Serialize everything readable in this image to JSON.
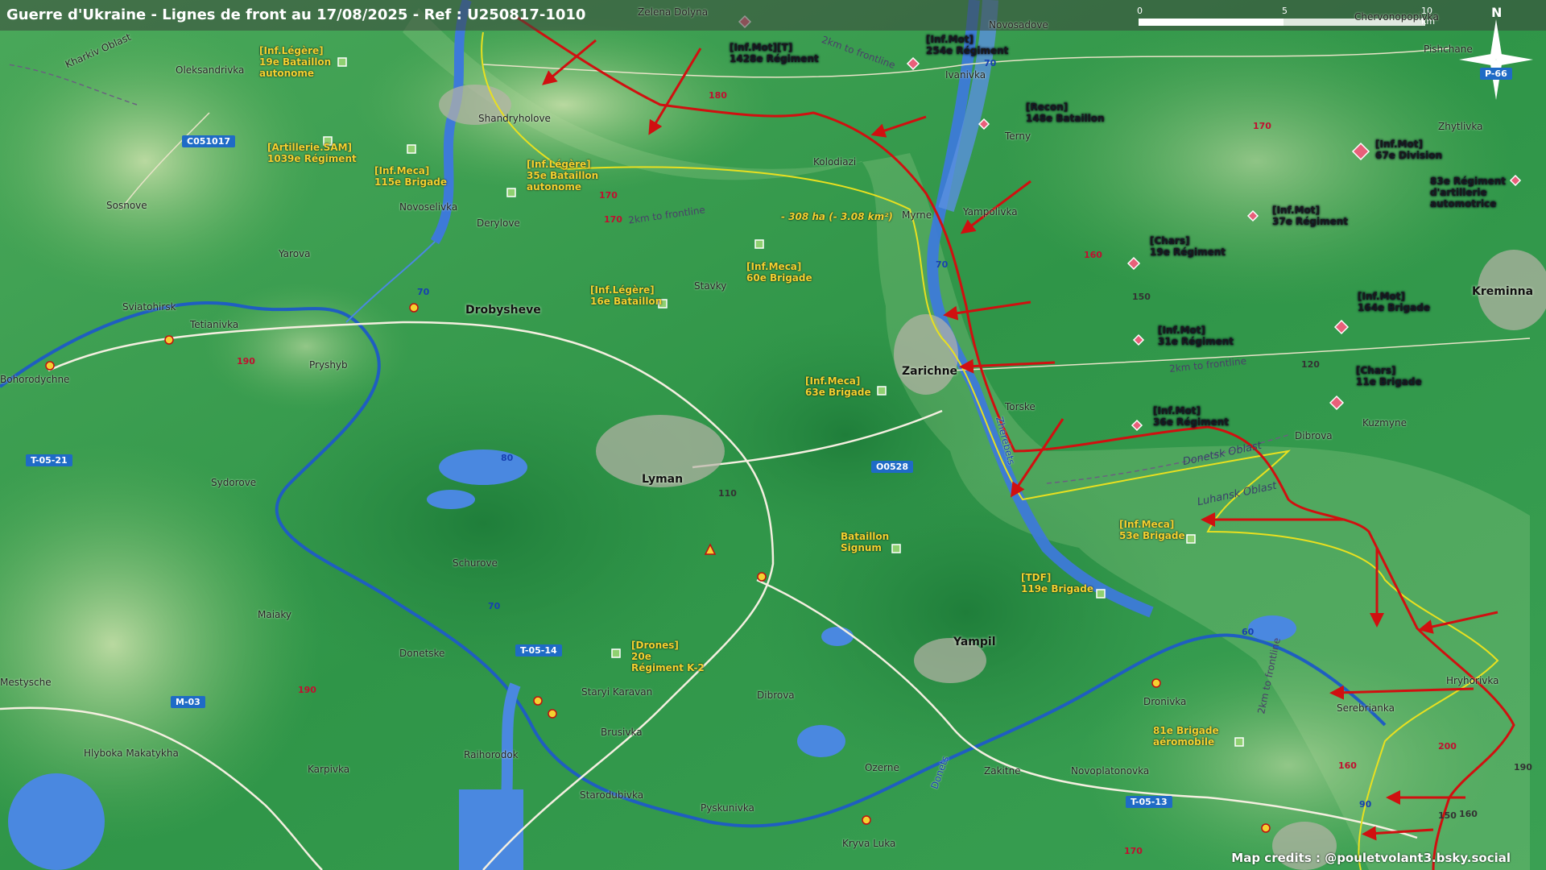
{
  "title": "Guerre d'Ukraine - Lignes de front au 17/08/2025 - Ref : U250817-1010",
  "credits": "Map credits : @pouletvolant3.bsky.social",
  "scale": {
    "labels": [
      "0",
      "5",
      "10 km"
    ]
  },
  "compass": {
    "north": "N",
    "icon": "compass-rose-icon"
  },
  "colors": {
    "ukraine": "#f5d130",
    "russia": "#e0283c",
    "front_line": "#d01010",
    "ua_frontline": "#e8e020"
  },
  "ukrainian_units": [
    {
      "id": "u1",
      "label": "[Inf.Légère]\n19e Bataillon\nautonome"
    },
    {
      "id": "u2",
      "label": "[Artillerie.SAM]\n1039e Régiment"
    },
    {
      "id": "u3",
      "label": "[Inf.Meca]\n115e Brigade"
    },
    {
      "id": "u4",
      "label": "[Inf.Légère]\n35e Bataillon\nautonome"
    },
    {
      "id": "u5",
      "label": "[Inf.Meca]\n60e Brigade"
    },
    {
      "id": "u6",
      "label": "[Inf.Légère]\n16e Bataillon"
    },
    {
      "id": "u7",
      "label": "[Inf.Meca]\n63e Brigade"
    },
    {
      "id": "u8",
      "label": "Bataillon\nSignum"
    },
    {
      "id": "u9",
      "label": "[TDF]\n119e Brigade"
    },
    {
      "id": "u10",
      "label": "[Inf.Meca]\n53e Brigade"
    },
    {
      "id": "u11",
      "label": "[Drones]\n20e\nRégiment K-2"
    },
    {
      "id": "u12",
      "label": "81e Brigade\naéromobile"
    }
  ],
  "russian_units": [
    {
      "id": "r1",
      "label": "[Inf.Mot][T]\n1428e Régiment"
    },
    {
      "id": "r2",
      "label": "[Inf.Mot]\n254e Régiment"
    },
    {
      "id": "r3",
      "label": "[Recon]\n148e Bataillon"
    },
    {
      "id": "r4",
      "label": "[Inf.Mot]\n67e Division"
    },
    {
      "id": "r5",
      "label": "83e Régiment\nd'artillerie\nautomotrice"
    },
    {
      "id": "r6",
      "label": "[Inf.Mot]\n37e Régiment"
    },
    {
      "id": "r7",
      "label": "[Chars]\n19e Régiment"
    },
    {
      "id": "r8",
      "label": "[Inf.Mot]\n164e Brigade"
    },
    {
      "id": "r9",
      "label": "[Inf.Mot]\n31e Régiment"
    },
    {
      "id": "r10",
      "label": "[Chars]\n11e Brigade"
    },
    {
      "id": "r11",
      "label": "[Inf.Mot]\n36e Régiment"
    }
  ],
  "cities": [
    "Drobysheve",
    "Lyman",
    "Zarichne",
    "Yampil",
    "Kreminna"
  ],
  "places": [
    "Zelena Dolyna",
    "Novosadove",
    "Chervonopopivka",
    "Pishchane",
    "Kharkiv Oblast",
    "Oleksandrivka",
    "Shandryholove",
    "Ivanivka",
    "Terny",
    "Zhytlivka",
    "Kolodiazi",
    "Myrne",
    "Yampolivka",
    "Sosnove",
    "Novoselivka",
    "Derylove",
    "Yarova",
    "Stavky",
    "Sviatohirsk",
    "Tetianivka",
    "Bohorodychne",
    "Pryshyb",
    "Torske",
    "Dibrova",
    "Kuzmyne",
    "Sydorove",
    "Schurove",
    "Maiaky",
    "Donetske",
    "Staryi Karavan",
    "Brusivka",
    "Raihorodok",
    "Dibrova",
    "Hlyboka Makatykha",
    "Karpivka",
    "Ozerne",
    "Zakitne",
    "Novoplatonovka",
    "Dronivka",
    "Serebrianka",
    "Hryhorivka",
    "Starodubivka",
    "Pyskunivka",
    "Kryva Luka",
    "Mestysche",
    "Zherebets",
    "Donets"
  ],
  "roads": [
    "C051017",
    "T-05-21",
    "T-05-14",
    "M-03",
    "O0528",
    "T-05-13",
    "P-66"
  ],
  "elevations_red": [
    "180",
    "170",
    "170",
    "170",
    "160",
    "190",
    "190",
    "160",
    "200",
    "170"
  ],
  "elevations_blue": [
    "70",
    "70",
    "70",
    "70",
    "80",
    "70",
    "60",
    "90"
  ],
  "elevations_black": [
    "150",
    "120",
    "110",
    "190",
    "150",
    "160"
  ],
  "front_labels": [
    "2km to frontline",
    "2km to frontline",
    "2km to frontline",
    "2km to frontline"
  ],
  "oblasts": [
    "Donetsk Oblast",
    "Luhansk Oblast"
  ],
  "area_note": "- 308 ha (- 3.08 km²)"
}
